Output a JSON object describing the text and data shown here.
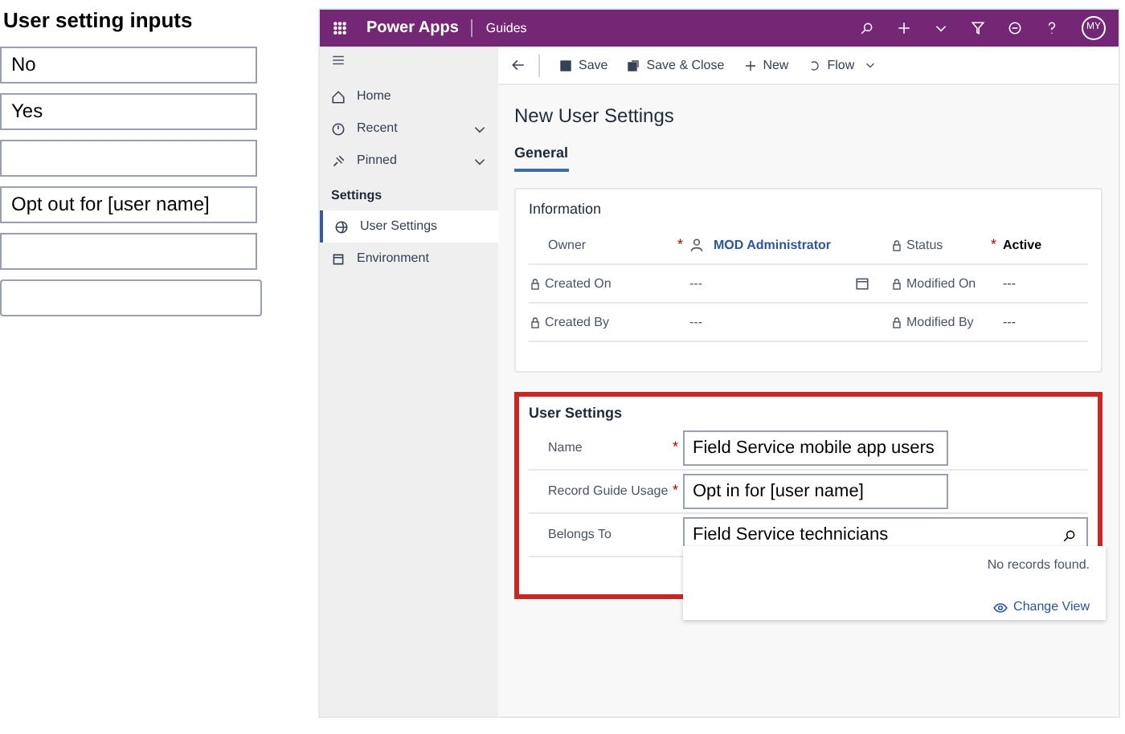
{
  "inputs_panel": {
    "title": "User setting inputs",
    "inputs": [
      {
        "kind": "filled",
        "value": "No"
      },
      {
        "kind": "filled",
        "value": "Yes"
      },
      {
        "kind": "empty"
      },
      {
        "kind": "filled",
        "value": "Opt out for [user name]"
      },
      {
        "kind": "empty"
      },
      {
        "kind": "empty"
      }
    ]
  },
  "app": {
    "header": {
      "app_name": "Power Apps",
      "area": "Guides",
      "avatar": "MY"
    },
    "sidebar": {
      "items": [
        {
          "label": "Home",
          "expandable": false,
          "selected": false
        },
        {
          "label": "Recent",
          "expandable": true,
          "selected": false
        },
        {
          "label": "Pinned",
          "expandable": true,
          "selected": false
        }
      ],
      "section": "Settings",
      "section_items": [
        {
          "label": "User Settings",
          "selected": true
        },
        {
          "label": "Environment",
          "selected": false
        }
      ]
    },
    "commands": [
      {
        "label": "Save",
        "dropdown": false
      },
      {
        "label": "Save & Close",
        "dropdown": false
      },
      {
        "label": "New",
        "dropdown": false
      },
      {
        "label": "Flow",
        "dropdown": true
      }
    ],
    "form": {
      "title": "New User Settings",
      "tabs": [
        {
          "label": "General",
          "selected": true
        }
      ],
      "information": {
        "heading": "Information",
        "rows": [
          {
            "label": "Owner",
            "locked": false,
            "required_mark": "*",
            "value": "MOD Administrator",
            "kind": "lookup",
            "label_2": "Status",
            "locked_2": true,
            "required_mark_2": "*",
            "value_2": "Active"
          },
          {
            "label": "Created On",
            "locked": true,
            "value": "---",
            "kind": "date",
            "label_2": "Modified On",
            "locked_2": true,
            "value_2": "---"
          },
          {
            "label": "Created By",
            "locked": true,
            "value": "---",
            "kind": "text",
            "label_2": "Modified By",
            "locked_2": true,
            "value_2": "---"
          }
        ]
      },
      "user_settings": {
        "heading": "User Settings",
        "fields": [
          {
            "label": "Name",
            "required_mark": "*",
            "value": "Field Service mobile app users",
            "kind": "text"
          },
          {
            "label": "Record Guide Usage",
            "required_mark": "*",
            "value": "Opt in for [user name]",
            "kind": "text"
          },
          {
            "label": "Belongs To",
            "value": "Field Service technicians",
            "kind": "search"
          }
        ]
      },
      "dropdown": {
        "message": "No records found.",
        "link": "Change View"
      }
    }
  }
}
